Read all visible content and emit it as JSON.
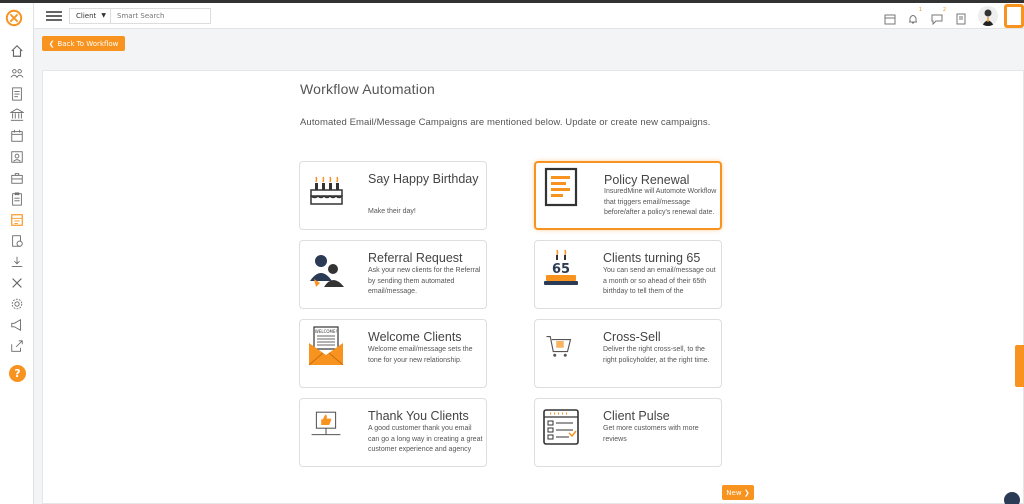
{
  "header": {
    "client_select": "Client",
    "search_placeholder": "Smart Search",
    "notification_count": "1",
    "chat_count": "2"
  },
  "back_button": "Back To Workflow",
  "page": {
    "title": "Workflow Automation",
    "subtitle": "Automated Email/Message Campaigns are mentioned below. Update or create new campaigns."
  },
  "cards": [
    {
      "title": "Say Happy Birthday",
      "desc": "Make their day!",
      "icon": "birthday-cake-icon"
    },
    {
      "title": "Policy Renewal",
      "desc": "InsuredMine will Automote Workflow that triggers email/message before/after a policy's renewal date.",
      "icon": "document-icon"
    },
    {
      "title": "Referral Request",
      "desc": "Ask your new clients for the Referral by sending them automated email/message.",
      "icon": "referral-people-icon"
    },
    {
      "title": "Clients turning 65",
      "desc": "You can send an email/message out a month or so ahead of their 65th birthday to tell them of the",
      "icon": "cake-65-icon"
    },
    {
      "title": "Welcome Clients",
      "desc": "Welcome email/message sets the tone for your new relationship.",
      "icon": "welcome-envelope-icon"
    },
    {
      "title": "Cross-Sell",
      "desc": "Deliver the right cross-sell, to the right policyholder, at the right time.",
      "icon": "shopping-cart-icon"
    },
    {
      "title": "Thank You Clients",
      "desc": "A good customer thank you email can go a long way in creating a great customer experience and agency",
      "icon": "thumbs-up-icon"
    },
    {
      "title": "Client Pulse",
      "desc": "Get more customers with more reviews",
      "icon": "survey-form-icon"
    }
  ],
  "cake_number": "65",
  "welcome_sign": "WELCOME!",
  "new_button": "New",
  "colors": {
    "accent": "#f7931e",
    "dark": "#2b3a55"
  }
}
